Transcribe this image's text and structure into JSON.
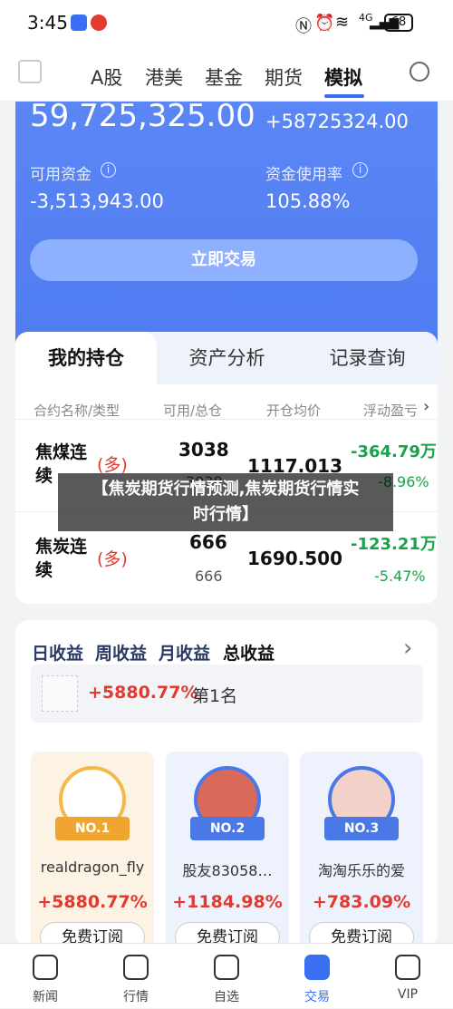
{
  "status": {
    "time": "3:45",
    "battery": "68",
    "network": "4G"
  },
  "nav": {
    "tabs": [
      "A股",
      "港美",
      "基金",
      "期货",
      "模拟"
    ],
    "active_tab": "模拟"
  },
  "account": {
    "total": "59,725,325.00",
    "change": "+58725324.00",
    "available_label": "可用资金",
    "available_value": "-3,513,943.00",
    "usage_label": "资金使用率",
    "usage_value": "105.88%",
    "trade_button": "立即交易"
  },
  "holdings": {
    "tabs": [
      "我的持仓",
      "资产分析",
      "记录查询"
    ],
    "columns": [
      "合约名称/类型",
      "可用/总仓",
      "开仓均价",
      "浮动盈亏"
    ],
    "rows": [
      {
        "name1": "焦煤连",
        "name2": "续",
        "dir": "(多)",
        "avail": "3038",
        "total": "3038",
        "price": "1117.013",
        "pnl": "-364.79万",
        "pct": "-8.96%"
      },
      {
        "name1": "焦炭连",
        "name2": "续",
        "dir": "(多)",
        "avail": "666",
        "total": "666",
        "price": "1690.500",
        "pnl": "-123.21万",
        "pct": "-5.47%"
      }
    ]
  },
  "ranking": {
    "periods": [
      "日收益",
      "周收益",
      "月收益",
      "总收益"
    ],
    "top": {
      "pct": "+5880.77%",
      "rank": "第1名"
    },
    "cards": [
      {
        "badge": "NO.1",
        "name": "realdragon_fly",
        "pct": "+5880.77%",
        "button": "免费订阅"
      },
      {
        "badge": "NO.2",
        "name": "股友83058…",
        "pct": "+1184.98%",
        "button": "免费订阅"
      },
      {
        "badge": "NO.3",
        "name": "淘淘乐乐的爱",
        "pct": "+783.09%",
        "button": "免费订阅"
      }
    ]
  },
  "bottom_nav": [
    "新闻",
    "行情",
    "自选",
    "交易",
    "VIP"
  ],
  "overlay": {
    "line1": "【焦炭期货行情预测,焦炭期货行情实",
    "line2": "时行情】"
  }
}
